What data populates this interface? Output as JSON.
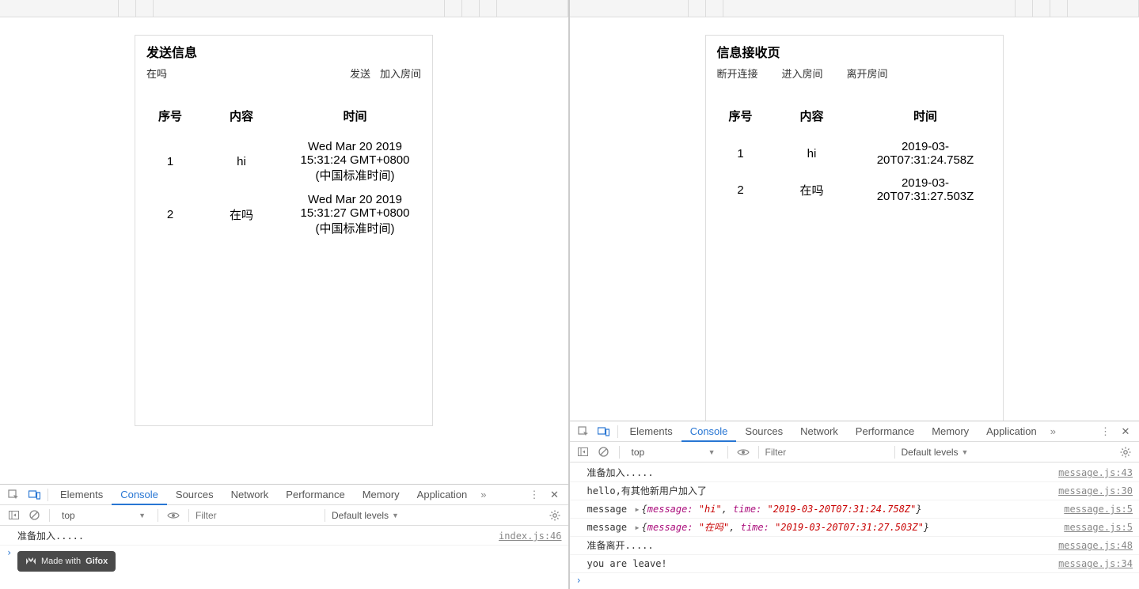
{
  "left": {
    "title": "发送信息",
    "input_value": "在吗",
    "buttons": {
      "send": "发送",
      "join": "加入房间"
    },
    "table": {
      "headers": {
        "index": "序号",
        "content": "内容",
        "time": "时间"
      },
      "rows": [
        {
          "index": "1",
          "content": "hi",
          "time": "Wed Mar 20 2019 15:31:24 GMT+0800 (中国标准时间)"
        },
        {
          "index": "2",
          "content": "在吗",
          "time": "Wed Mar 20 2019 15:31:27 GMT+0800 (中国标准时间)"
        }
      ]
    }
  },
  "right": {
    "title": "信息接收页",
    "buttons": {
      "disconnect": "断开连接",
      "enter": "进入房间",
      "leave": "离开房间"
    },
    "table": {
      "headers": {
        "index": "序号",
        "content": "内容",
        "time": "时间"
      },
      "rows": [
        {
          "index": "1",
          "content": "hi",
          "time": "2019-03-20T07:31:24.758Z"
        },
        {
          "index": "2",
          "content": "在吗",
          "time": "2019-03-20T07:31:27.503Z"
        }
      ]
    }
  },
  "devtools": {
    "tabs": {
      "elements": "Elements",
      "console": "Console",
      "sources": "Sources",
      "network": "Network",
      "performance": "Performance",
      "memory": "Memory",
      "application": "Application"
    },
    "context": "top",
    "filter_placeholder": "Filter",
    "levels": "Default levels"
  },
  "console_left": {
    "lines": [
      {
        "msg": "准备加入.....",
        "src": "index.js:46"
      }
    ]
  },
  "console_right": {
    "lines": [
      {
        "type": "text",
        "msg": "准备加入.....",
        "src": "message.js:43"
      },
      {
        "type": "text",
        "msg": "hello,有其他新用户加入了",
        "src": "message.js:30"
      },
      {
        "type": "obj",
        "prefix": "message",
        "body": "{message: \"hi\", time: \"2019-03-20T07:31:24.758Z\"}",
        "src": "message.js:5"
      },
      {
        "type": "obj",
        "prefix": "message",
        "body": "{message: \"在吗\", time: \"2019-03-20T07:31:27.503Z\"}",
        "src": "message.js:5"
      },
      {
        "type": "text",
        "msg": "准备离开.....",
        "src": "message.js:48"
      },
      {
        "type": "text",
        "msg": "you are leave!",
        "src": "message.js:34"
      }
    ]
  },
  "badge": {
    "prefix": "Made with",
    "brand": "Gifox"
  }
}
